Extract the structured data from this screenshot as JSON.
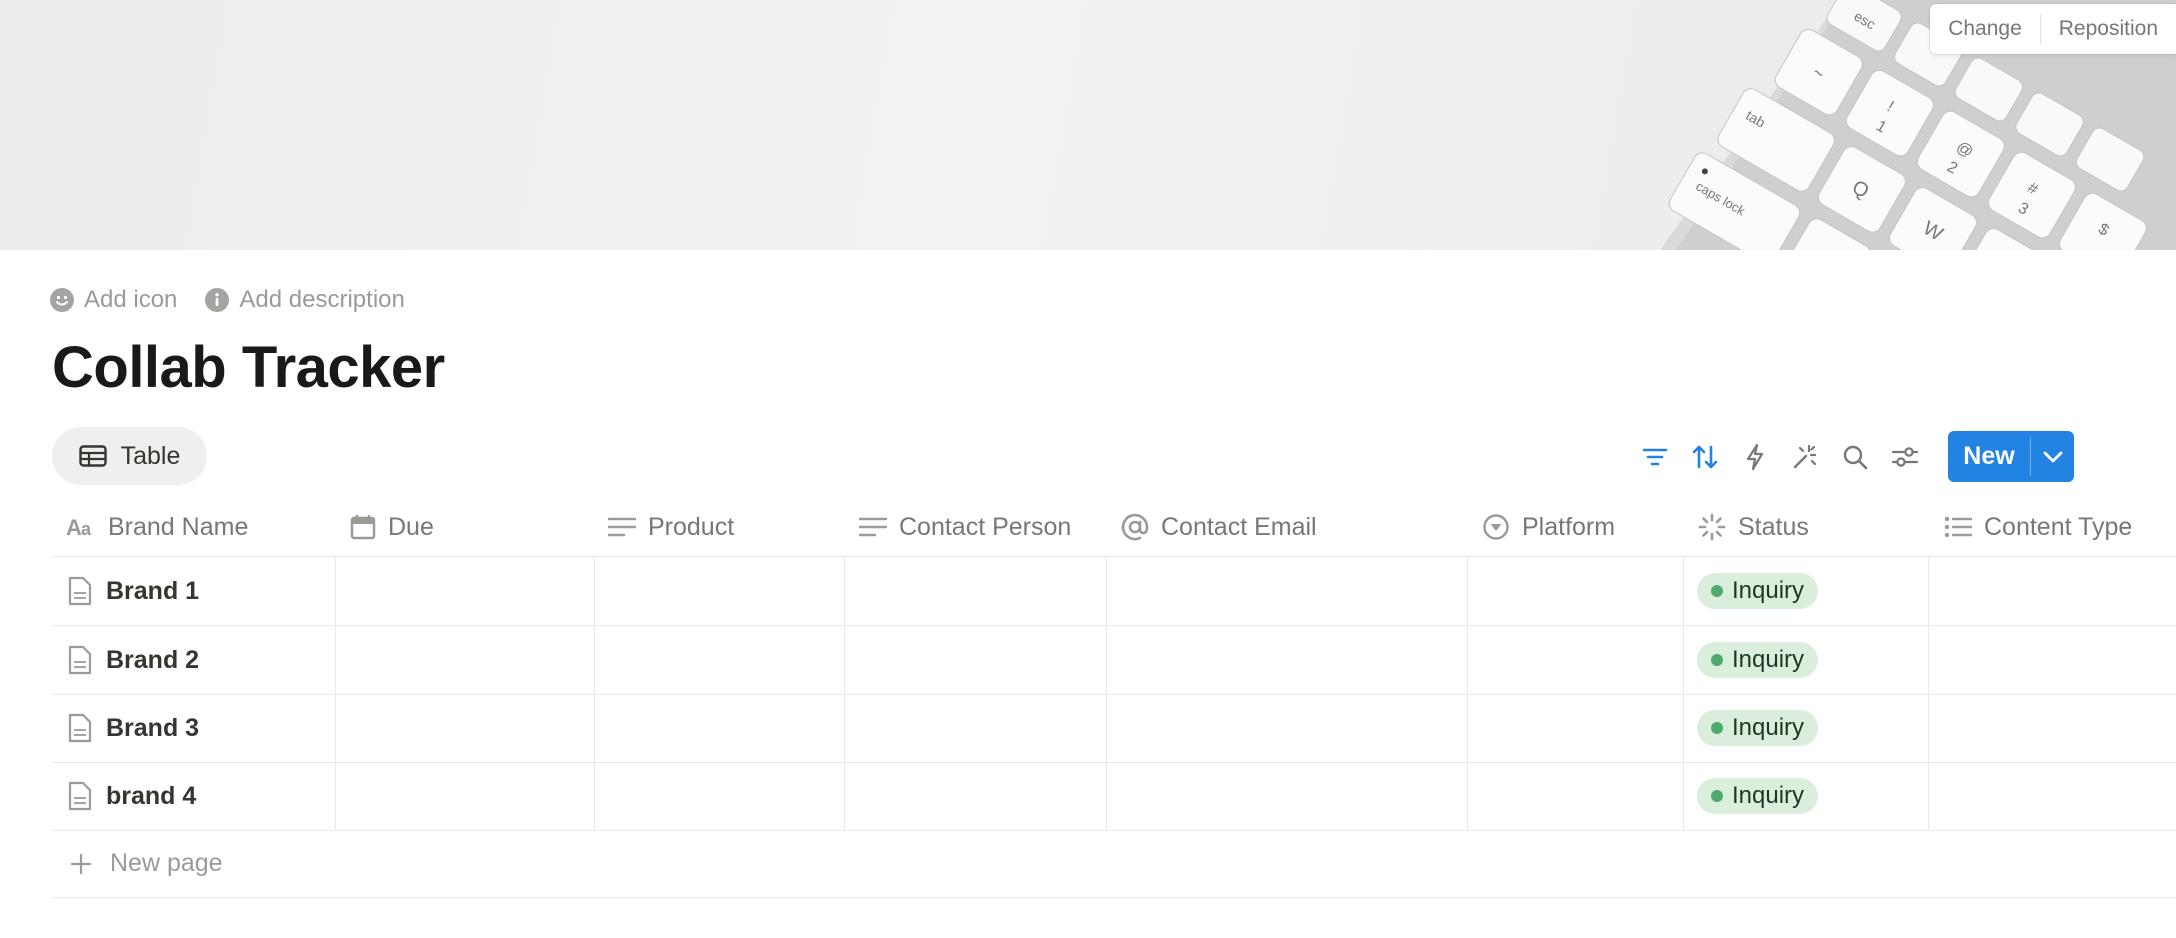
{
  "cover": {
    "change_label": "Change",
    "reposition_label": "Reposition",
    "key_labels": [
      "esc",
      "~",
      "!",
      "@",
      "#",
      "$",
      "tab",
      "Q",
      "W",
      "caps lock",
      "1",
      "2",
      "3"
    ]
  },
  "page": {
    "add_icon_label": "Add icon",
    "add_description_label": "Add description",
    "title": "Collab Tracker"
  },
  "view": {
    "tab_label": "Table",
    "new_label": "New"
  },
  "toolbar": {
    "icons": [
      "filter-icon",
      "sort-icon",
      "automation-icon",
      "ai-sparkle-icon",
      "search-icon",
      "settings-sliders-icon",
      "chevron-down-icon"
    ]
  },
  "table": {
    "columns": [
      {
        "label": "Brand Name",
        "icon": "title-text-icon"
      },
      {
        "label": "Due",
        "icon": "calendar-icon"
      },
      {
        "label": "Product",
        "icon": "text-lines-icon"
      },
      {
        "label": "Contact Person",
        "icon": "text-lines-icon"
      },
      {
        "label": "Contact Email",
        "icon": "at-sign-icon"
      },
      {
        "label": "Platform",
        "icon": "select-icon"
      },
      {
        "label": "Status",
        "icon": "status-icon"
      },
      {
        "label": "Content Type",
        "icon": "list-icon"
      }
    ],
    "rows": [
      {
        "name": "Brand 1",
        "status": "Inquiry"
      },
      {
        "name": "Brand 2",
        "status": "Inquiry"
      },
      {
        "name": "Brand 3",
        "status": "Inquiry"
      },
      {
        "name": "brand 4",
        "status": "Inquiry"
      }
    ],
    "new_page_label": "New page"
  },
  "colors": {
    "accent": "#2383e2",
    "status_inquiry_bg": "#dbeddb",
    "status_inquiry_dot": "#4dab6f",
    "title_text": "#191919",
    "muted_text": "#787774"
  }
}
